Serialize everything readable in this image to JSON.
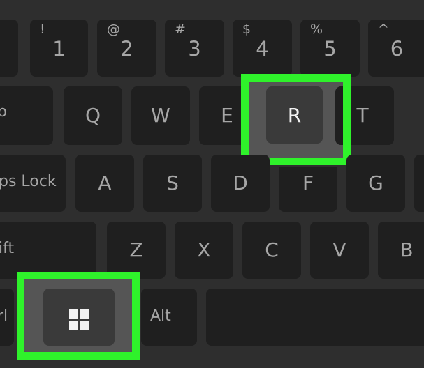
{
  "keyboard": {
    "number_row": [
      {
        "shift": "!",
        "main": "1"
      },
      {
        "shift": "@",
        "main": "2"
      },
      {
        "shift": "#",
        "main": "3"
      },
      {
        "shift": "$",
        "main": "4"
      },
      {
        "shift": "%",
        "main": "5"
      },
      {
        "shift": "^",
        "main": "6"
      }
    ],
    "qwerty_row": {
      "tab": "b",
      "keys": [
        "Q",
        "W",
        "E",
        "R",
        "T"
      ]
    },
    "home_row": {
      "caps": "ps Lock",
      "keys": [
        "A",
        "S",
        "D",
        "F",
        "G"
      ]
    },
    "bottom_letter_row": {
      "shift": "ift",
      "keys": [
        "Z",
        "X",
        "C",
        "V",
        "B"
      ]
    },
    "space_row": {
      "ctrl": "rl",
      "win_key": "windows-logo",
      "alt": "Alt"
    },
    "highlighted_keys": [
      "Windows",
      "R"
    ],
    "highlight_color": "#2ff22b"
  }
}
